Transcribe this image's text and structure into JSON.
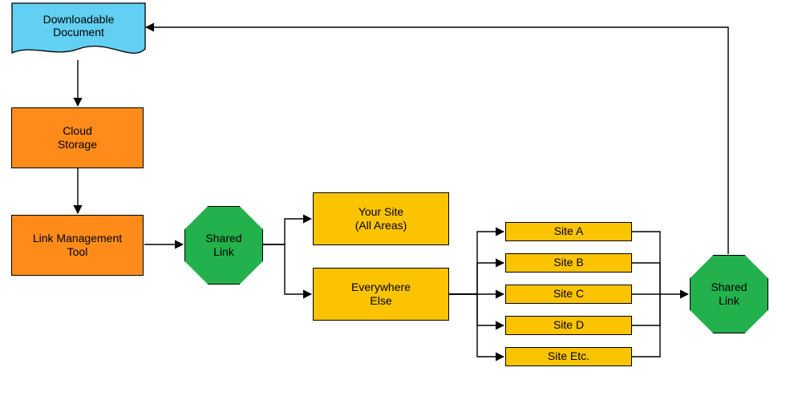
{
  "nodes": {
    "document": "Downloadable\nDocument",
    "cloud_storage": "Cloud\nStorage",
    "link_tool": "Link Management\nTool",
    "shared_link_1": "Shared\nLink",
    "your_site": "Your Site\n(All Areas)",
    "everywhere_else": "Everywhere\nElse",
    "site_a": "Site A",
    "site_b": "Site B",
    "site_c": "Site C",
    "site_d": "Site D",
    "site_etc": "Site Etc.",
    "shared_link_2": "Shared\nLink"
  },
  "colors": {
    "document_fill": "#61d0f2",
    "process_fill": "#ff8c1a",
    "site_fill": "#fcc400",
    "terminal_fill": "#22b14c",
    "stroke": "#000000"
  },
  "diagram": {
    "type": "flowchart",
    "edges": [
      {
        "from": "document",
        "to": "cloud_storage"
      },
      {
        "from": "cloud_storage",
        "to": "link_tool"
      },
      {
        "from": "link_tool",
        "to": "shared_link_1"
      },
      {
        "from": "shared_link_1",
        "to": "your_site"
      },
      {
        "from": "shared_link_1",
        "to": "everywhere_else"
      },
      {
        "from": "everywhere_else",
        "to": "site_a"
      },
      {
        "from": "everywhere_else",
        "to": "site_b"
      },
      {
        "from": "everywhere_else",
        "to": "site_c"
      },
      {
        "from": "everywhere_else",
        "to": "site_d"
      },
      {
        "from": "everywhere_else",
        "to": "site_etc"
      },
      {
        "from": "site_a",
        "to": "shared_link_2"
      },
      {
        "from": "site_b",
        "to": "shared_link_2"
      },
      {
        "from": "site_c",
        "to": "shared_link_2"
      },
      {
        "from": "site_d",
        "to": "shared_link_2"
      },
      {
        "from": "site_etc",
        "to": "shared_link_2"
      },
      {
        "from": "shared_link_2",
        "to": "document"
      }
    ]
  }
}
